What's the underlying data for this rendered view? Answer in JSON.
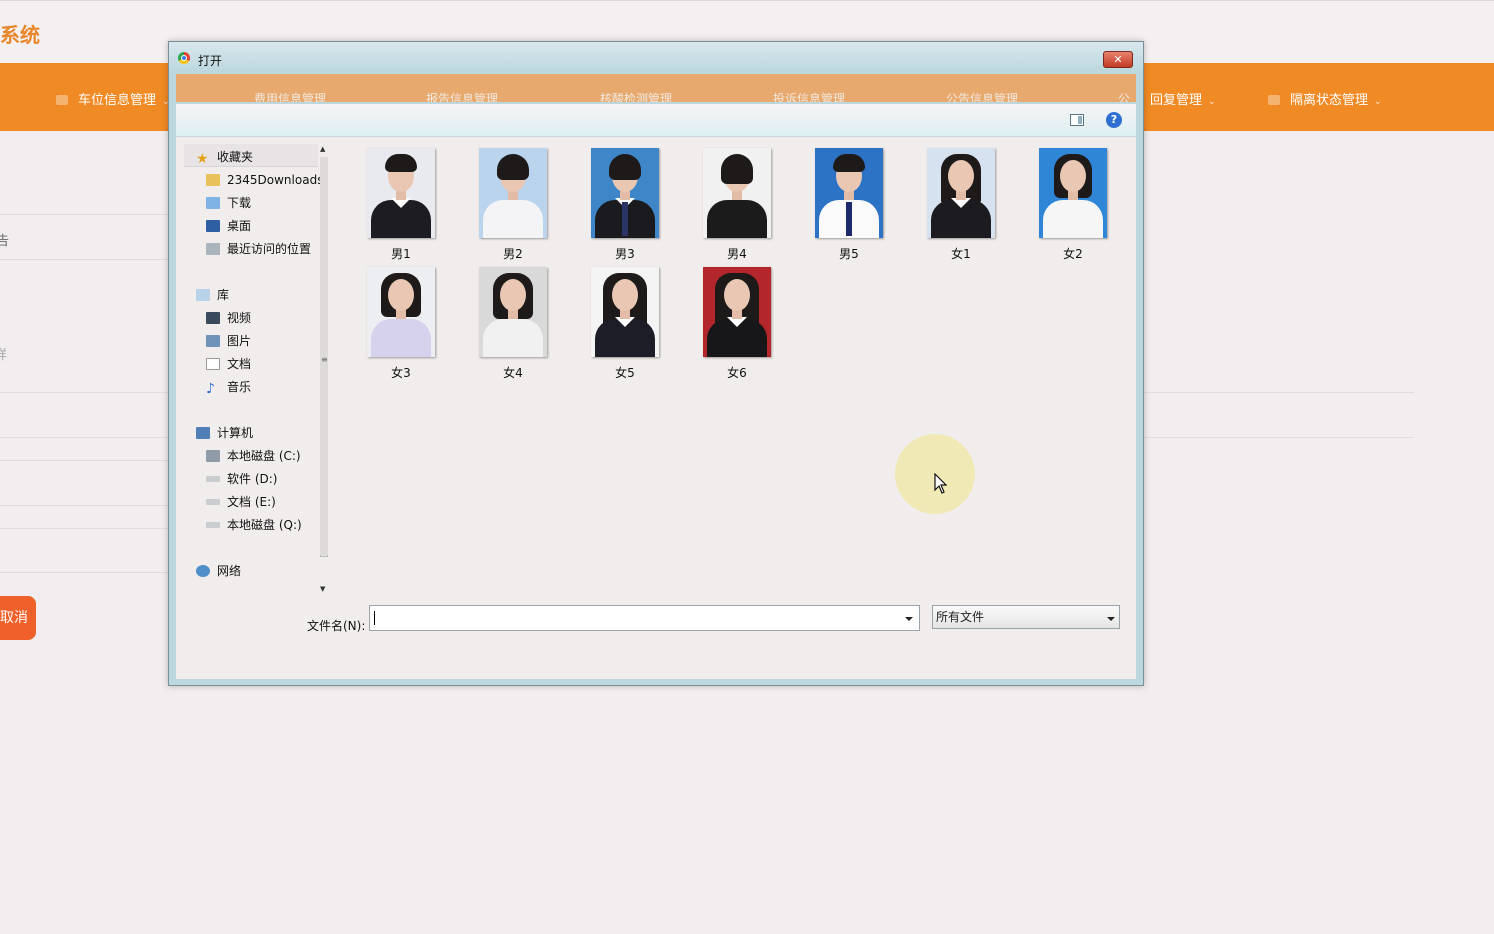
{
  "app": {
    "title_partial": "系统",
    "nav_items": [
      "车位信息管理",
      "回复管理",
      "隔离状态管理"
    ],
    "side_fragments": [
      "告",
      "详"
    ],
    "cancel_partial": "取消"
  },
  "dialog": {
    "title": "打开",
    "close_label": "✕",
    "help_label": "?",
    "ghost_nav": [
      "费用信息管理",
      "报告信息管理",
      "核酸检测管理",
      "投诉信息管理",
      "公告信息管理",
      "公"
    ],
    "nav_groups": {
      "favorites": {
        "label": "收藏夹",
        "items": [
          "2345Downloads",
          "下载",
          "桌面",
          "最近访问的位置"
        ]
      },
      "libraries": {
        "label": "库",
        "items": [
          "视频",
          "图片",
          "文档",
          "音乐"
        ]
      },
      "computer": {
        "label": "计算机",
        "items": [
          "本地磁盘 (C:)",
          "软件 (D:)",
          "文档 (E:)",
          "本地磁盘 (Q:)"
        ]
      },
      "network": {
        "label": "网络"
      }
    },
    "files": [
      "男1",
      "男2",
      "男3",
      "男4",
      "男5",
      "女1",
      "女2",
      "女3",
      "女4",
      "女5",
      "女6"
    ],
    "filename_label": "文件名(N):",
    "filename_value": "",
    "filetype_value": "所有文件"
  },
  "colors": {
    "accent": "#f08a24",
    "dialog_frame": "#bcd7de",
    "close": "#c23a22"
  }
}
